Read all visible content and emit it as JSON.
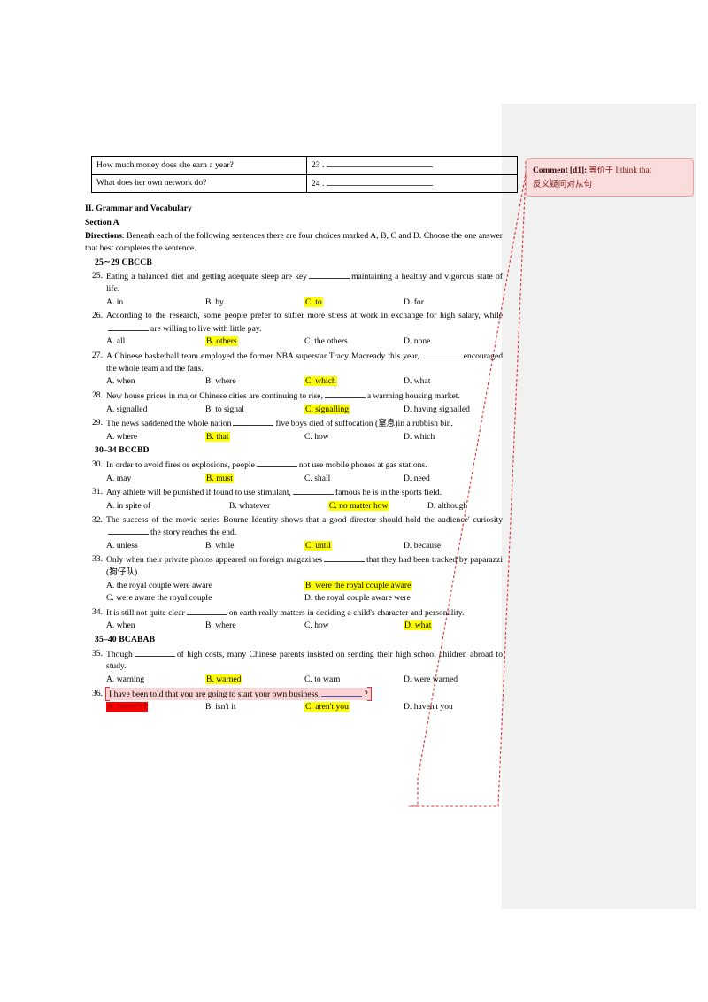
{
  "document": {
    "table": {
      "rows": [
        {
          "question": "How much money does she earn a year?",
          "number": "23 ."
        },
        {
          "question": "What does her own network do?",
          "number": "24 ."
        }
      ]
    },
    "headings": {
      "section_title": "II. Grammar and Vocabulary",
      "section_part": "Section A",
      "directions_label": "Directions",
      "directions_text": ": Beneath each of the following sentences there are four choices marked A, B, C and D. Choose the one answer that best completes the sentence."
    },
    "answer_keys": {
      "key_25_29": "25∼29 CBCCB",
      "key_30_34": "30–34 BCCBD",
      "key_35_40": "35–40 BCABAB"
    },
    "questions": [
      {
        "number": "25.",
        "stem_a": "Eating a balanced diet and getting adequate sleep are key",
        "stem_b": "maintaining a healthy and vigorous state of life.",
        "options": [
          {
            "label": "A. in",
            "highlight": "none"
          },
          {
            "label": "B. by",
            "highlight": "none"
          },
          {
            "label": "C. to",
            "highlight": "yellow"
          },
          {
            "label": "D. for",
            "highlight": "none"
          }
        ]
      },
      {
        "number": "26.",
        "stem_a": "According to the research, some people prefer to suffer more stress at work in exchange for high salary, while",
        "stem_b": "are willing to live with little pay.",
        "options": [
          {
            "label": "A. all",
            "highlight": "none"
          },
          {
            "label": "B. others",
            "highlight": "yellow"
          },
          {
            "label": "C. the others",
            "highlight": "none"
          },
          {
            "label": "D. none",
            "highlight": "none"
          }
        ]
      },
      {
        "number": "27.",
        "stem_a": "A Chinese basketball team employed the former NBA superstar Tracy Macready this year,",
        "stem_b": "encouraged the whole team and the fans.",
        "options": [
          {
            "label": "A. when",
            "highlight": "none"
          },
          {
            "label": "B. where",
            "highlight": "none"
          },
          {
            "label": "C. which",
            "highlight": "yellow"
          },
          {
            "label": "D. what",
            "highlight": "none"
          }
        ]
      },
      {
        "number": "28.",
        "stem_a": "New house prices in major Chinese cities are continuing to rise,",
        "stem_b": "a warming housing market.",
        "options": [
          {
            "label": "A. signalled",
            "highlight": "none"
          },
          {
            "label": "B. to signal",
            "highlight": "none"
          },
          {
            "label": "C. signalling",
            "highlight": "yellow"
          },
          {
            "label": "D. having signalled",
            "highlight": "none"
          }
        ]
      },
      {
        "number": "29.",
        "stem_a": "The news saddened the whole nation",
        "stem_b": "five boys died of suffocation (窒息)in a rubbish bin.",
        "options": [
          {
            "label": "A. where",
            "highlight": "none"
          },
          {
            "label": "B. that",
            "highlight": "yellow"
          },
          {
            "label": "C. how",
            "highlight": "none"
          },
          {
            "label": "D. which",
            "highlight": "none"
          }
        ]
      },
      {
        "number": "30.",
        "stem_a": "In order to avoid fires or explosions, people",
        "stem_b": "not use mobile phones at gas stations.",
        "options": [
          {
            "label": "A. may",
            "highlight": "none"
          },
          {
            "label": "B. must",
            "highlight": "yellow"
          },
          {
            "label": "C. shall",
            "highlight": "none"
          },
          {
            "label": "D. need",
            "highlight": "none"
          }
        ]
      },
      {
        "number": "31.",
        "stem_a": "Any athlete will be punished if found to use stimulant,",
        "stem_b": "famous he is in the sports field.",
        "options": [
          {
            "label": "A. in spite of",
            "highlight": "none"
          },
          {
            "label": "B. whatever",
            "highlight": "none"
          },
          {
            "label": "C. no matter how",
            "highlight": "yellow"
          },
          {
            "label": "D. although",
            "highlight": "none"
          }
        ]
      },
      {
        "number": "32.",
        "stem_a": "The success of the movie series Bourne Identity shows that a good director should hold the audience' curiosity",
        "stem_b": "the story reaches the end.",
        "options": [
          {
            "label": "A. unless",
            "highlight": "none"
          },
          {
            "label": "B. while",
            "highlight": "none"
          },
          {
            "label": "C. until",
            "highlight": "yellow"
          },
          {
            "label": "D. because",
            "highlight": "none"
          }
        ]
      },
      {
        "number": "33.",
        "stem_a": "Only when their private photos appeared on foreign magazines",
        "stem_b": "that they had been tracked by paparazzi (狗仔队).",
        "options": [
          {
            "label": "A. the royal couple were aware",
            "highlight": "none"
          },
          {
            "label": "B. were the royal couple aware",
            "highlight": "yellow"
          },
          {
            "label": "C. were aware the royal couple",
            "highlight": "none"
          },
          {
            "label": "D. the royal couple aware were",
            "highlight": "none"
          }
        ]
      },
      {
        "number": "34.",
        "stem_a": "It is still not quite clear",
        "stem_b": "on earth really matters in deciding a child's character and personality.",
        "options": [
          {
            "label": "A. when",
            "highlight": "none"
          },
          {
            "label": "B. where",
            "highlight": "none"
          },
          {
            "label": "C. how",
            "highlight": "none"
          },
          {
            "label": "D. what",
            "highlight": "yellow"
          }
        ]
      },
      {
        "number": "35.",
        "stem_a": "Though",
        "stem_b": "of high costs, many Chinese parents insisted on sending their high school children abroad to study.",
        "options": [
          {
            "label": "A. warning",
            "highlight": "none"
          },
          {
            "label": "B. warned",
            "highlight": "yellow"
          },
          {
            "label": "C. to warn",
            "highlight": "none"
          },
          {
            "label": "D. were warned",
            "highlight": "none"
          }
        ]
      },
      {
        "number": "36.",
        "stem_a": "I have been told that you are going to start your own business,",
        "stem_b": "?",
        "options": [
          {
            "label": "A. haven't I",
            "highlight": "red"
          },
          {
            "label": "B. isn't it",
            "highlight": "none"
          },
          {
            "label": "C. aren't you",
            "highlight": "yellow"
          },
          {
            "label": "D. haven't you",
            "highlight": "none"
          }
        ]
      }
    ]
  },
  "comment": {
    "label": "Comment [d1]:",
    "text_cn": "等价于",
    "text_en": "I think that",
    "emphasis_dots": "· · · · ·",
    "line2": "反义疑问对从句"
  },
  "colors": {
    "highlight_yellow": "#ffff00",
    "highlight_red": "#ff0000",
    "comment_bg": "#fbdcdc",
    "comment_border": "#e8a0a0",
    "leader_line": "#e03030",
    "margin_bg": "#f1f1f1"
  }
}
